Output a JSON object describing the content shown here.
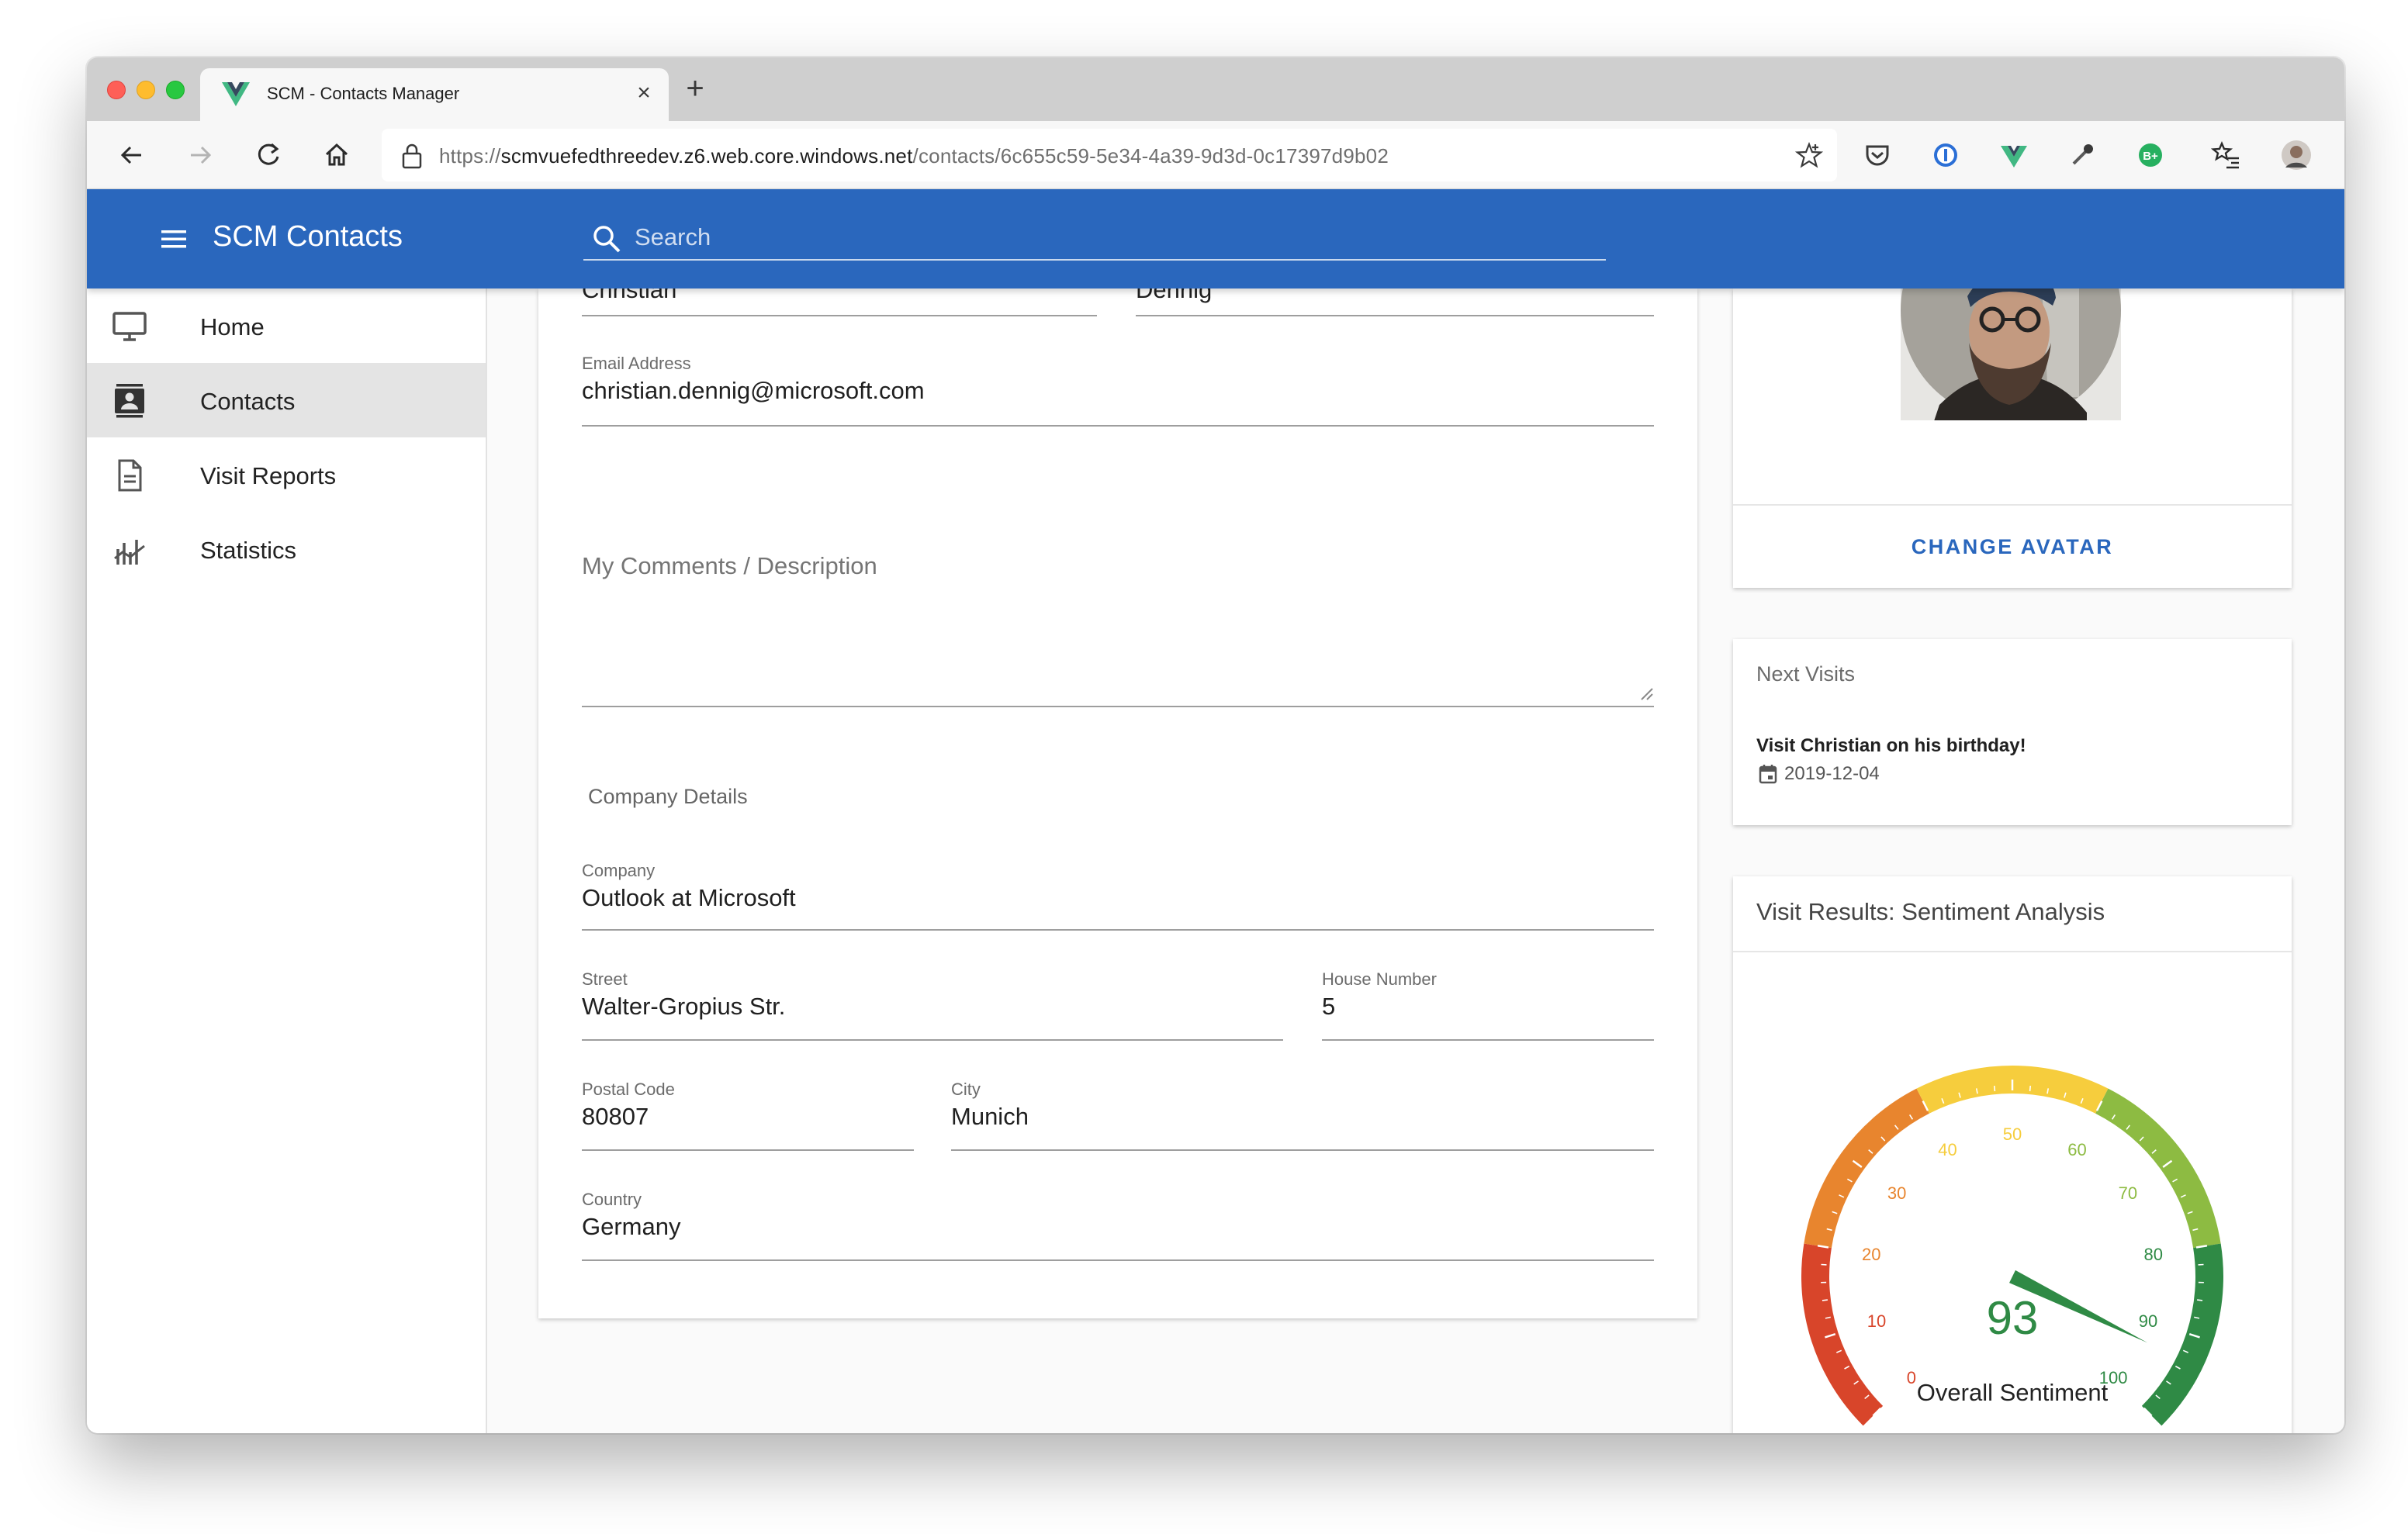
{
  "browser": {
    "tab_title": "SCM - Contacts Manager",
    "url_prefix": "https://",
    "url_host": "scmvuefedthreedev.z6.web.core.windows.net",
    "url_path": "/contacts/6c655c59-5e34-4a39-9d3d-0c17397d9b02"
  },
  "app": {
    "title": "SCM Contacts",
    "search_placeholder": "Search",
    "accent_color": "#2a67bd"
  },
  "sidebar": {
    "items": [
      {
        "label": "Home",
        "icon": "monitor-icon",
        "active": false
      },
      {
        "label": "Contacts",
        "icon": "contact-card-icon",
        "active": true
      },
      {
        "label": "Visit Reports",
        "icon": "document-icon",
        "active": false
      },
      {
        "label": "Statistics",
        "icon": "chart-icon",
        "active": false
      }
    ]
  },
  "contact_form": {
    "first_name": "Christian",
    "last_name": "Dennig",
    "email_label": "Email Address",
    "email": "christian.dennig@microsoft.com",
    "comments_label": "My Comments / Description",
    "comments": "",
    "company_section_title": "Company Details",
    "company_label": "Company",
    "company": "Outlook at Microsoft",
    "street_label": "Street",
    "street": "Walter-Gropius Str.",
    "house_number_label": "House Number",
    "house_number": "5",
    "postal_code_label": "Postal Code",
    "postal_code": "80807",
    "city_label": "City",
    "city": "Munich",
    "country_label": "Country",
    "country": "Germany"
  },
  "avatar_card": {
    "button_label": "CHANGE AVATAR"
  },
  "next_visits": {
    "title": "Next Visits",
    "items": [
      {
        "name": "Visit Christian on his birthday!",
        "date": "2019-12-04"
      }
    ]
  },
  "sentiment": {
    "title": "Visit Results: Sentiment Analysis",
    "value_text": "93",
    "caption": "Overall Sentiment",
    "tick_labels": [
      "0",
      "10",
      "20",
      "30",
      "40",
      "50",
      "60",
      "70",
      "80",
      "90",
      "100"
    ]
  },
  "chart_data": {
    "type": "gauge",
    "value": 93,
    "min": 0,
    "max": 100,
    "label": "Overall Sentiment",
    "ticks": [
      0,
      10,
      20,
      30,
      40,
      50,
      60,
      70,
      80,
      90,
      100
    ],
    "bands": [
      {
        "from": 0,
        "to": 20,
        "color": "#d8452a"
      },
      {
        "from": 20,
        "to": 40,
        "color": "#e8852e"
      },
      {
        "from": 40,
        "to": 60,
        "color": "#f6cd3d"
      },
      {
        "from": 60,
        "to": 80,
        "color": "#8dbb42"
      },
      {
        "from": 80,
        "to": 100,
        "color": "#2f8a45"
      }
    ],
    "needle_color": "#2f8a45"
  }
}
